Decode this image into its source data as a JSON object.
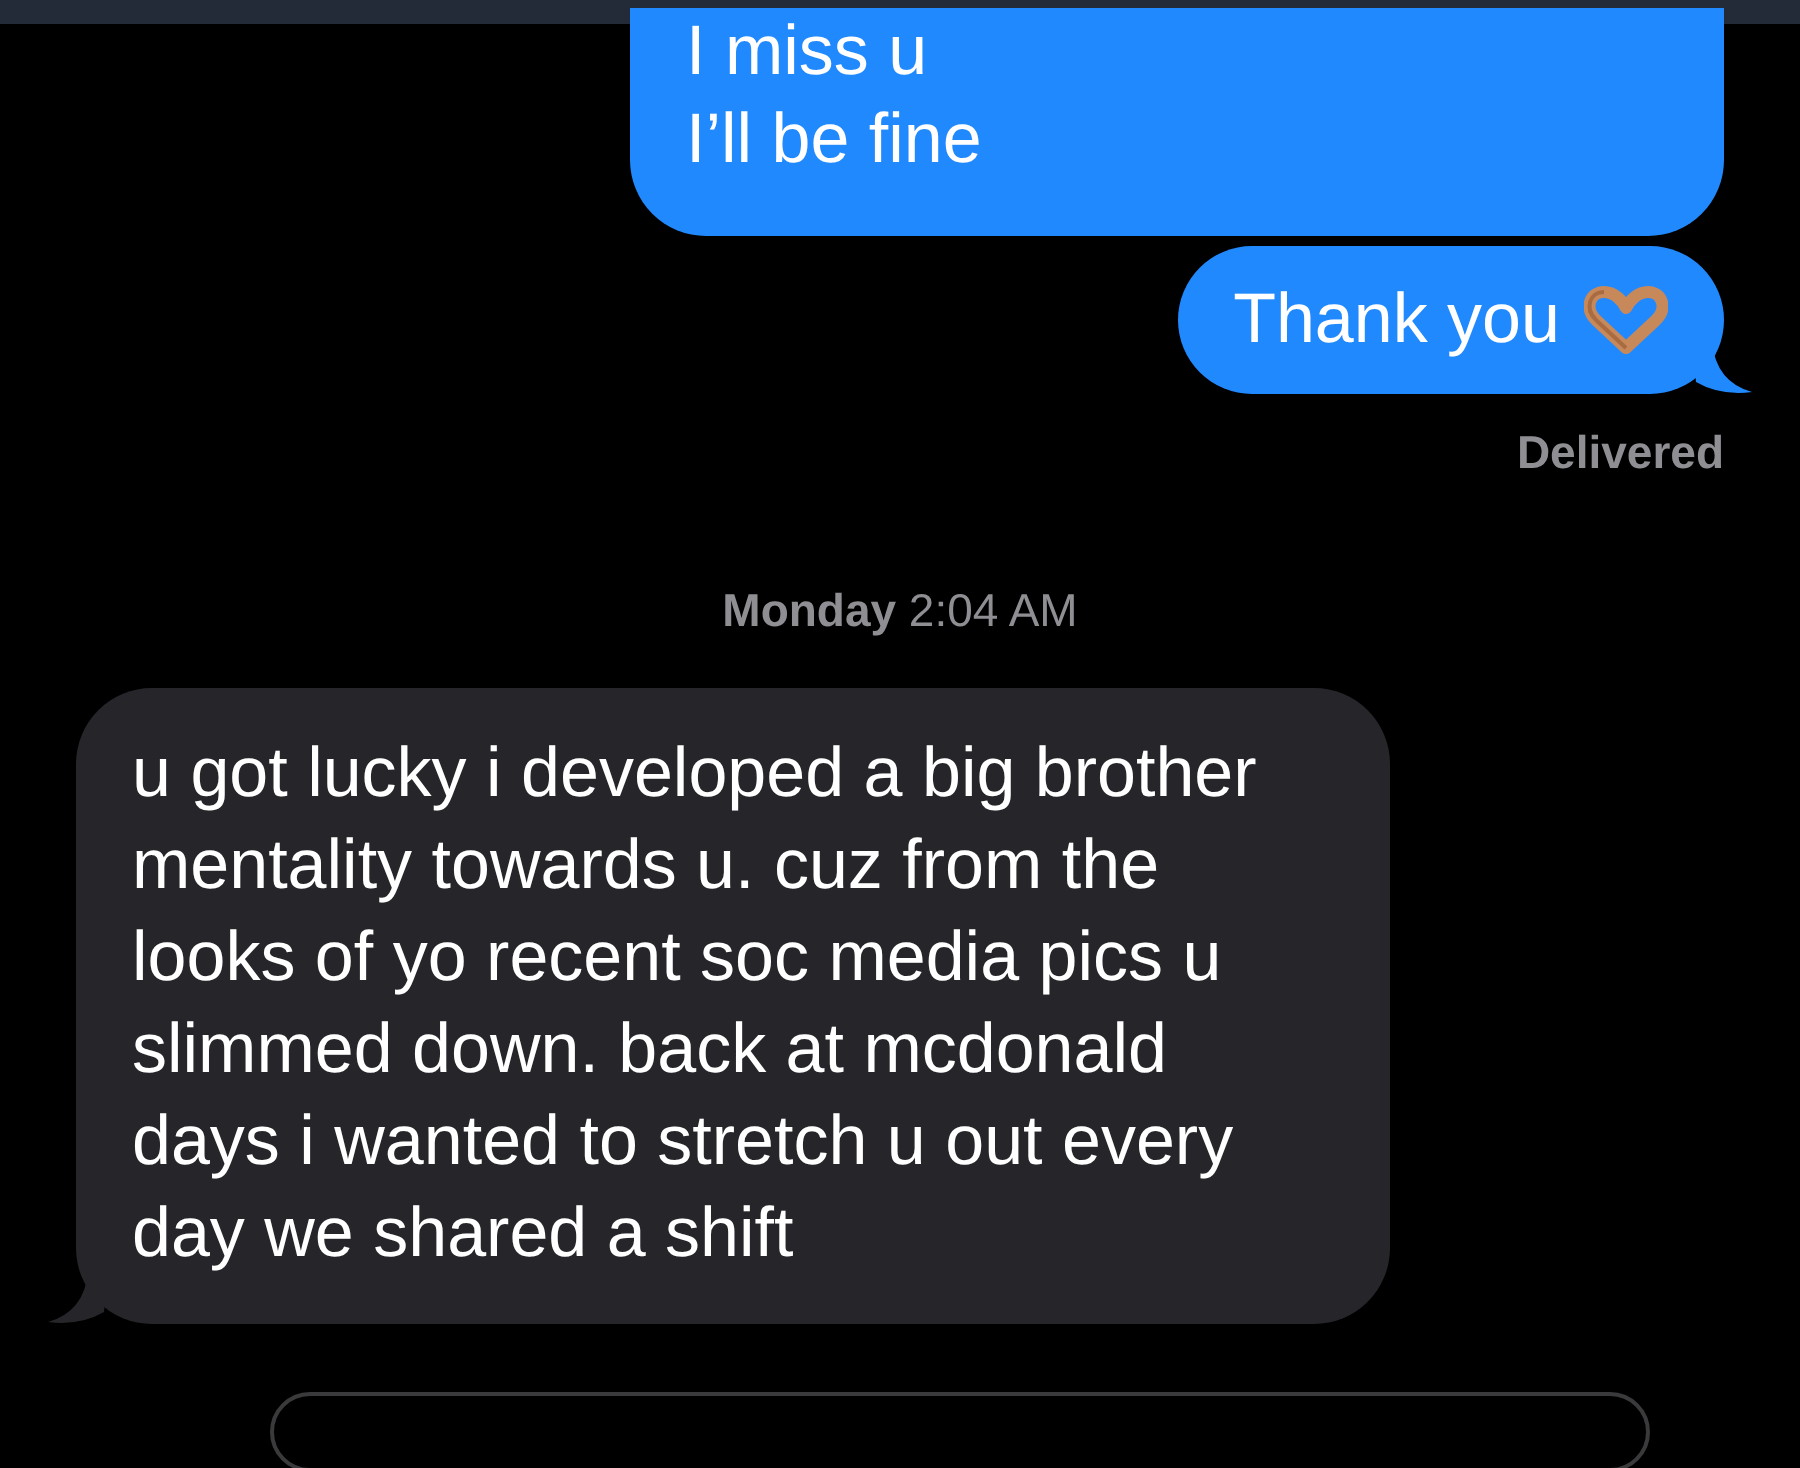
{
  "messages": [
    {
      "kind": "sent",
      "lines": [
        "I miss u",
        "I’ll be fine"
      ],
      "cut_top": true
    },
    {
      "kind": "sent_heart",
      "text": "Thank you",
      "tail": true
    },
    {
      "kind": "status",
      "text": "Delivered"
    },
    {
      "kind": "timestamp",
      "text": "**Monday** 2:04 AM"
    },
    {
      "kind": "received",
      "text": "u got lucky i developed a big brother mentality towards u. cuz from the looks of yo recent soc media pics u slimmed down. back at mcdonald days i wanted to stretch u out every day we shared a shift",
      "tail": true
    }
  ],
  "composer": {
    "kind": "field"
  }
}
